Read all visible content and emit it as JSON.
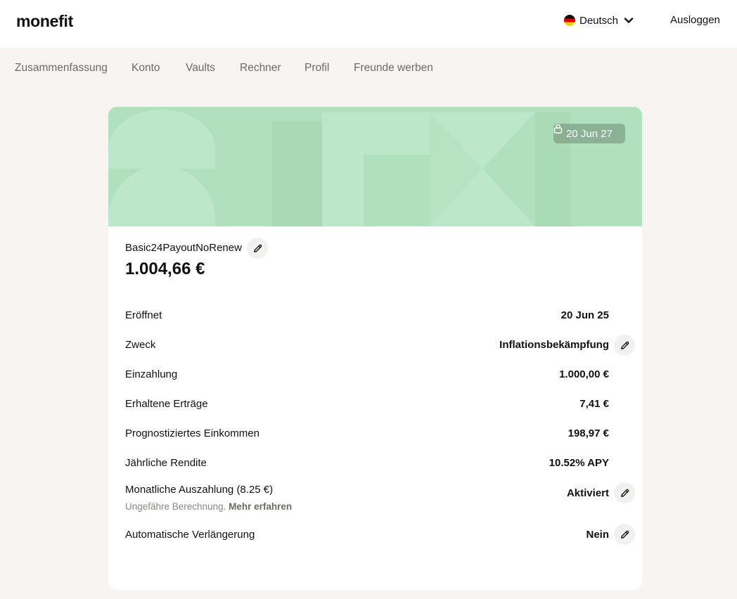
{
  "app": {
    "logo": "monefit"
  },
  "header": {
    "language": "Deutsch",
    "logout": "Ausloggen"
  },
  "nav": {
    "items": [
      "Zusammenfassung",
      "Konto",
      "Vaults",
      "Rechner",
      "Profil",
      "Freunde werben"
    ]
  },
  "vault": {
    "lock_date": "20 Jun 27",
    "name": "Basic24PayoutNoRenew",
    "balance": "1.004,66 €",
    "banner_color": "#b0e0be",
    "rows": {
      "opened": {
        "label": "Eröffnet",
        "value": "20 Jun 25"
      },
      "purpose": {
        "label": "Zweck",
        "value": "Inflationsbekämpfung"
      },
      "deposit": {
        "label": "Einzahlung",
        "value": "1.000,00 €"
      },
      "earnings": {
        "label": "Erhaltene Erträge",
        "value": "7,41 €"
      },
      "projected": {
        "label": "Prognostiziertes Einkommen",
        "value": "198,97 €"
      },
      "yield": {
        "label": "Jährliche Rendite",
        "value": "10.52% APY"
      },
      "payout": {
        "label": "Monatliche Auszahlung (8.25 €)",
        "value": "Aktiviert",
        "note": "Ungefähre Berechnung.",
        "note_link": "Mehr erfahren"
      },
      "renewal": {
        "label": "Automatische Verlängerung",
        "value": "Nein"
      }
    }
  }
}
